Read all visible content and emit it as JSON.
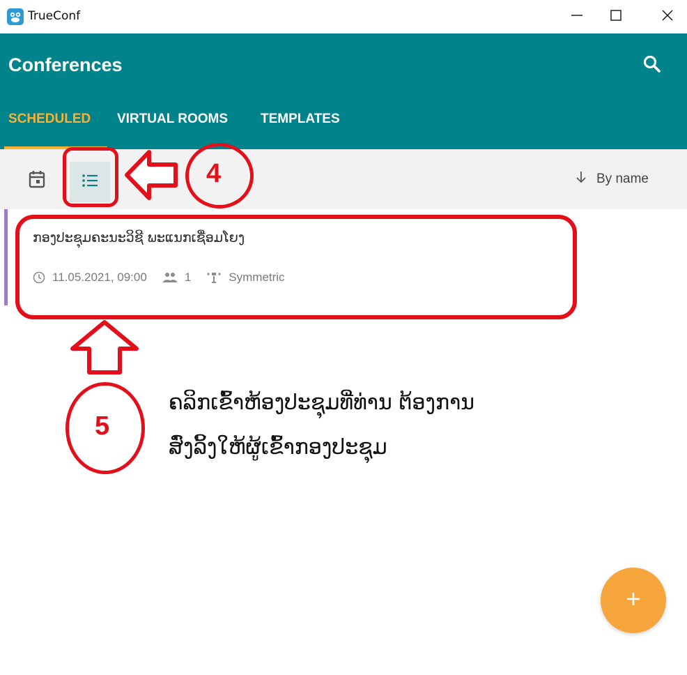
{
  "window": {
    "title": "TrueConf",
    "icon": "trueconf-logo-icon",
    "controls": [
      "minimize-icon",
      "maximize-icon",
      "close-icon"
    ]
  },
  "header": {
    "title": "Conferences",
    "search_icon": "search-icon",
    "background": "#00838a",
    "accent": "#f9b233"
  },
  "tabs": [
    {
      "label": "SCHEDULED",
      "active": true
    },
    {
      "label": "VIRTUAL ROOMS",
      "active": false
    },
    {
      "label": "TEMPLATES",
      "active": false
    }
  ],
  "toolbar": {
    "view_modes": [
      {
        "icon": "calendar-icon",
        "selected": false
      },
      {
        "icon": "list-icon",
        "selected": true
      }
    ],
    "sort_icon": "arrow-down-icon",
    "sort_label": "By name"
  },
  "conferences": [
    {
      "title": "ກອງປະຊຸມຄະນະວິຊີ ພະແນກເຊື່ອມໂຍງ",
      "datetime": "11.05.2021, 09:00",
      "participants": "1",
      "mode": "Symmetric",
      "accent": "#9b7ec8"
    }
  ],
  "annotations": {
    "step4": "4",
    "step5": "5",
    "instruction_line1": "ຄລິກເຂົ້າຫ້ອງປະຊຸມທີ່ທ່ານ ຕ້ອງການ",
    "instruction_line2": "ສົ່ງລິ້ງໃຫ້ຜູ້ເຂົ້າກອງປະຊຸມ",
    "color": "#e3101b"
  },
  "fab": {
    "icon": "plus-icon",
    "color": "#f6a53c"
  }
}
